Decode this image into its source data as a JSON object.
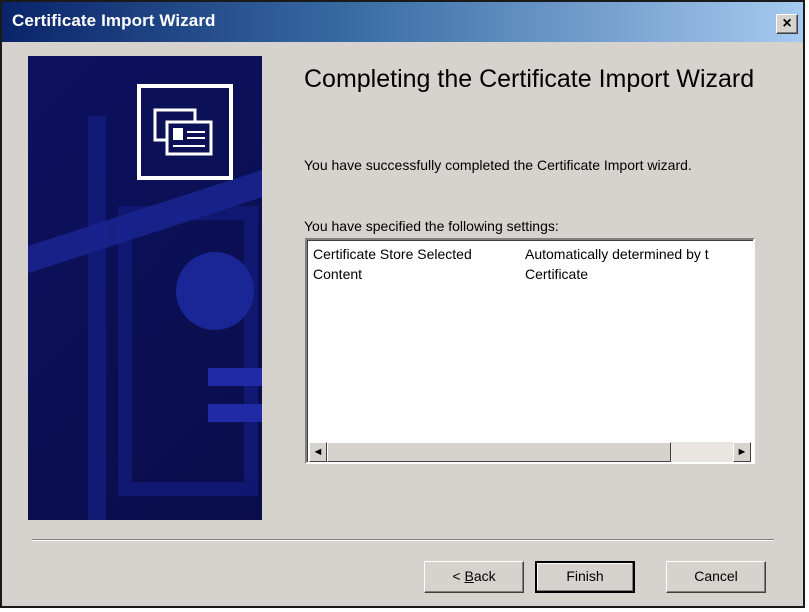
{
  "window": {
    "title": "Certificate Import Wizard",
    "close_glyph": "×"
  },
  "banner": {
    "icon": "certificate-icon"
  },
  "content": {
    "heading": "Completing the Certificate Import Wizard",
    "intro": "You have successfully completed the Certificate Import wizard.",
    "settings_label": "You have specified the following settings:",
    "settings": [
      {
        "name": "Certificate Store Selected",
        "value": "Automatically determined by t"
      },
      {
        "name": "Content",
        "value": "Certificate"
      }
    ]
  },
  "scrollbar": {
    "left_arrow": "◄",
    "right_arrow": "►"
  },
  "buttons": {
    "back_prefix": "< ",
    "back_hotkey": "B",
    "back_rest": "ack",
    "finish": "Finish",
    "cancel": "Cancel"
  }
}
